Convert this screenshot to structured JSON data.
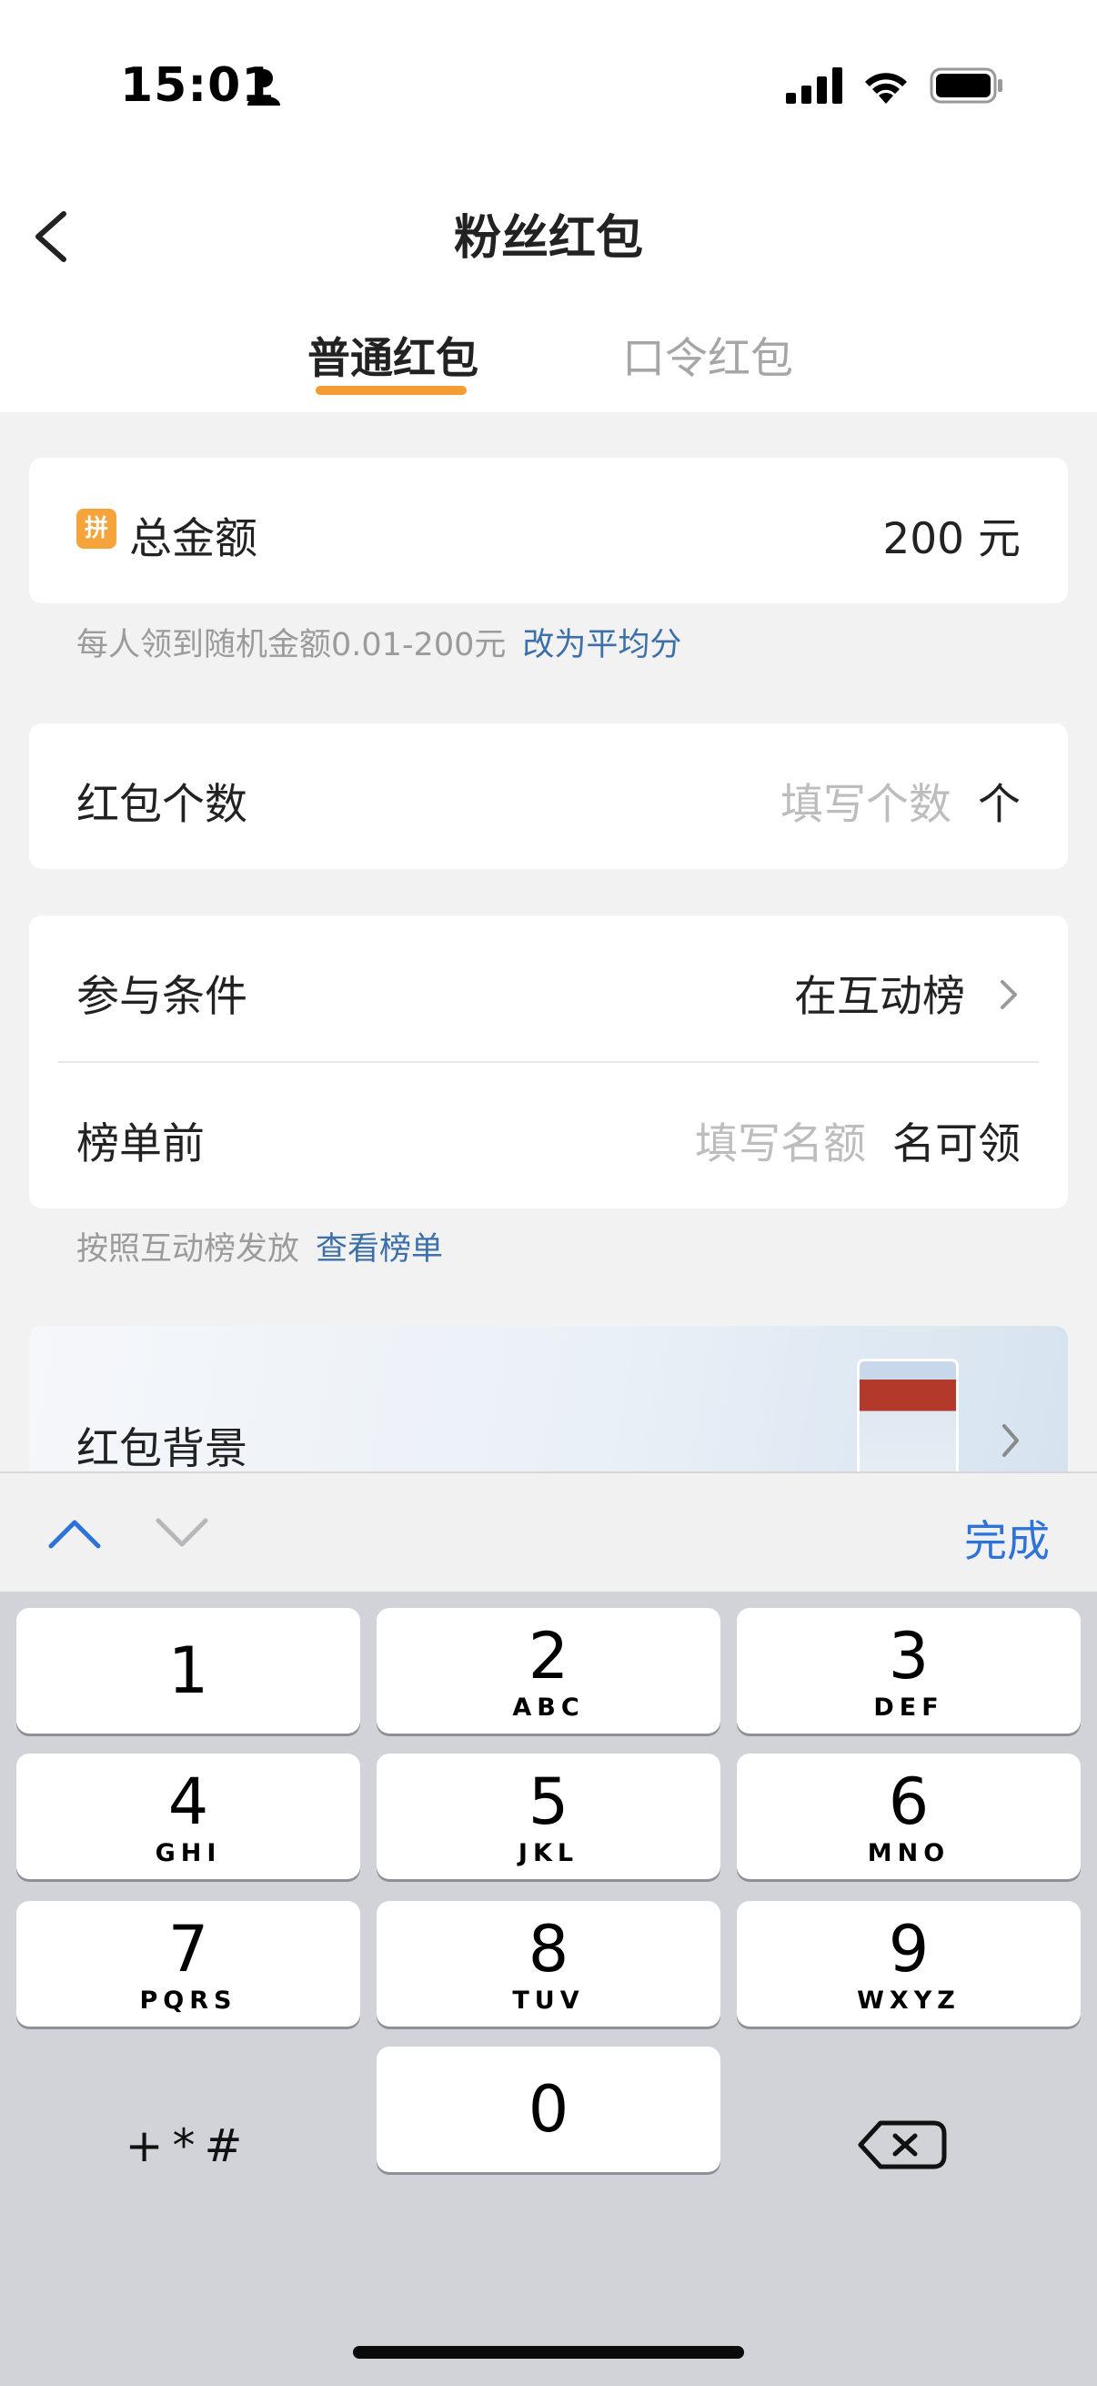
{
  "status_bar": {
    "time": "15:01"
  },
  "nav": {
    "title": "粉丝红包"
  },
  "tabs": [
    {
      "label": "普通红包",
      "active": true
    },
    {
      "label": "口令红包",
      "active": false
    }
  ],
  "total": {
    "badge": "拼",
    "label": "总金额",
    "value": "200 元"
  },
  "total_hint": {
    "text": "每人领到随机金额0.01-200元",
    "link": "改为平均分"
  },
  "count": {
    "label": "红包个数",
    "placeholder": "填写个数",
    "unit": "个"
  },
  "condition": {
    "label": "参与条件",
    "value": "在互动榜"
  },
  "rank": {
    "label": "榜单前",
    "placeholder": "填写名额",
    "unit": "名可领"
  },
  "rank_hint": {
    "text": "按照互动榜发放",
    "link": "查看榜单"
  },
  "background": {
    "label": "红包背景"
  },
  "keyboard": {
    "done_label": "完成",
    "keys": [
      {
        "digit": "1",
        "letters": ""
      },
      {
        "digit": "2",
        "letters": "ABC"
      },
      {
        "digit": "3",
        "letters": "DEF"
      },
      {
        "digit": "4",
        "letters": "GHI"
      },
      {
        "digit": "5",
        "letters": "JKL"
      },
      {
        "digit": "6",
        "letters": "MNO"
      },
      {
        "digit": "7",
        "letters": "PQRS"
      },
      {
        "digit": "8",
        "letters": "TUV"
      },
      {
        "digit": "9",
        "letters": "WXYZ"
      },
      {
        "digit": "0",
        "letters": ""
      }
    ],
    "symbols_label": "+*#"
  },
  "colors": {
    "accent": "#f39c34",
    "link": "#3d6fa8",
    "done": "#2d73d9"
  }
}
